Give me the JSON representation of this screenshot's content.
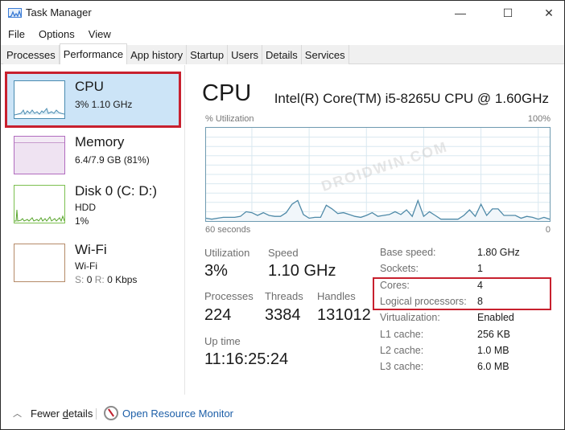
{
  "window": {
    "title": "Task Manager",
    "controls": {
      "minimize": "—",
      "maximize": "☐",
      "close": "✕"
    }
  },
  "menu": [
    "File",
    "Options",
    "View"
  ],
  "tabs": [
    {
      "label": "Processes",
      "active": false
    },
    {
      "label": "Performance",
      "active": true
    },
    {
      "label": "App history",
      "active": false
    },
    {
      "label": "Startup",
      "active": false
    },
    {
      "label": "Users",
      "active": false
    },
    {
      "label": "Details",
      "active": false
    },
    {
      "label": "Services",
      "active": false
    }
  ],
  "sidebar": {
    "items": [
      {
        "title": "CPU",
        "line1": "3%  1.10 GHz",
        "color": "#4a8bb0",
        "selected": true
      },
      {
        "title": "Memory",
        "line1": "6.4/7.9 GB (81%)",
        "color": "#9b4fa8"
      },
      {
        "title": "Disk 0 (C: D:)",
        "line1": "HDD",
        "line2": "1%",
        "color": "#5aa62e"
      },
      {
        "title": "Wi-Fi",
        "line1": "Wi-Fi",
        "line2_s_label": "S:",
        "line2_s_val": "0",
        "line2_r_label": "R:",
        "line2_r_val": "0 Kbps",
        "color": "#a7714a"
      }
    ]
  },
  "main": {
    "title": "CPU",
    "model": "Intel(R) Core(TM) i5-8265U CPU @ 1.60GHz",
    "graph": {
      "top_left_label": "% Utilization",
      "top_right_label": "100%",
      "bottom_left_label": "60 seconds",
      "bottom_right_label": "0",
      "watermark": "DROIDWIN.COM"
    },
    "stats": {
      "utilization_label": "Utilization",
      "utilization": "3%",
      "speed_label": "Speed",
      "speed": "1.10 GHz",
      "processes_label": "Processes",
      "processes": "224",
      "threads_label": "Threads",
      "threads": "3384",
      "handles_label": "Handles",
      "handles": "131012",
      "uptime_label": "Up time",
      "uptime": "11:16:25:24"
    },
    "specs": [
      {
        "label": "Base speed:",
        "value": "1.80 GHz"
      },
      {
        "label": "Sockets:",
        "value": "1"
      },
      {
        "label": "Cores:",
        "value": "4"
      },
      {
        "label": "Logical processors:",
        "value": "8"
      },
      {
        "label": "Virtualization:",
        "value": "Enabled"
      },
      {
        "label": "L1 cache:",
        "value": "256 KB"
      },
      {
        "label": "L2 cache:",
        "value": "1.0 MB"
      },
      {
        "label": "L3 cache:",
        "value": "6.0 MB"
      }
    ]
  },
  "footer": {
    "fewer_details_pre": "Fewer ",
    "fewer_details_u": "d",
    "fewer_details_post": "etails",
    "open_resource_monitor": "Open Resource Monitor"
  },
  "chart_data": {
    "type": "area",
    "title": "% Utilization",
    "xlabel": "60 seconds",
    "ylabel": "% Utilization",
    "ylim": [
      0,
      100
    ],
    "xlim": [
      60,
      0
    ],
    "grid": true,
    "x": [
      60,
      59,
      58,
      57,
      56,
      55,
      54,
      53,
      52,
      51,
      50,
      49,
      48,
      47,
      46,
      45,
      44,
      43,
      42,
      41,
      40,
      39,
      38,
      37,
      36,
      35,
      34,
      33,
      32,
      31,
      30,
      29,
      28,
      27,
      26,
      25,
      24,
      23,
      22,
      21,
      20,
      19,
      18,
      17,
      16,
      15,
      14,
      13,
      12,
      11,
      10,
      9,
      8,
      7,
      6,
      5,
      4,
      3,
      2,
      1,
      0
    ],
    "series": [
      {
        "name": "CPU",
        "values": [
          3,
          2,
          3,
          4,
          4,
          4,
          5,
          10,
          9,
          6,
          9,
          6,
          5,
          5,
          9,
          18,
          22,
          7,
          3,
          4,
          4,
          17,
          13,
          8,
          9,
          7,
          5,
          4,
          6,
          9,
          5,
          6,
          7,
          10,
          7,
          12,
          5,
          22,
          5,
          10,
          6,
          2,
          2,
          2,
          2,
          6,
          12,
          5,
          18,
          6,
          13,
          13,
          6,
          6,
          6,
          3,
          5,
          4,
          2,
          4,
          2
        ]
      }
    ]
  }
}
